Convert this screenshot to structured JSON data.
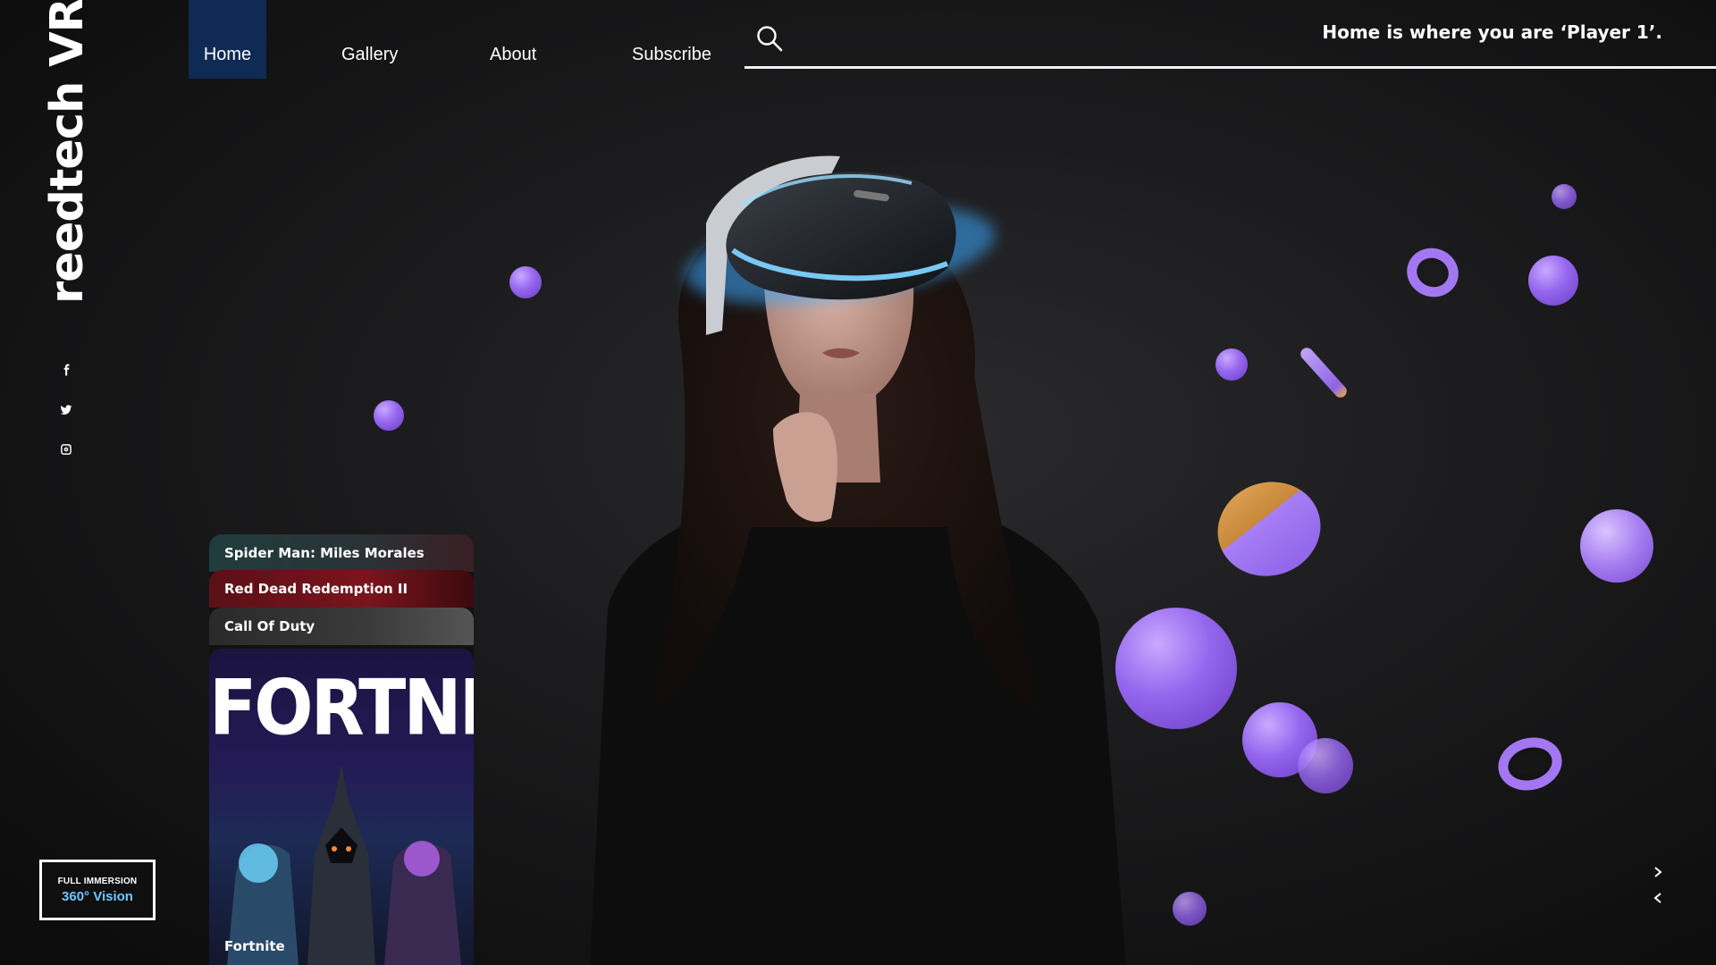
{
  "brand": {
    "name": "reedtech VR"
  },
  "social": [
    {
      "name": "facebook-icon"
    },
    {
      "name": "twitter-icon"
    },
    {
      "name": "instagram-icon"
    }
  ],
  "nav": {
    "items": [
      {
        "label": "Home",
        "active": true
      },
      {
        "label": "Gallery",
        "active": false
      },
      {
        "label": "About",
        "active": false
      },
      {
        "label": "Subscribe",
        "active": false
      }
    ],
    "search_icon": "search-icon"
  },
  "tagline": "Home is where you are ‘Player 1’.",
  "badge": {
    "top": "FULL IMMERSION",
    "main": "360° Vision"
  },
  "games": {
    "items": [
      {
        "label": "Spider Man: Miles Morales"
      },
      {
        "label": "Red Dead Redemption II"
      },
      {
        "label": "Call Of Duty"
      }
    ],
    "featured": {
      "logo_text": "FORTNITE",
      "label": "Fortnite"
    }
  },
  "carousel": {
    "next_icon": "chevron-right-icon",
    "prev_icon": "chevron-left-icon"
  },
  "colors": {
    "accent_purple": "#9566ee",
    "nav_active": "#0f2a55",
    "badge_text": "#6bc7ff",
    "vr_glow": "#3aa8ff"
  }
}
